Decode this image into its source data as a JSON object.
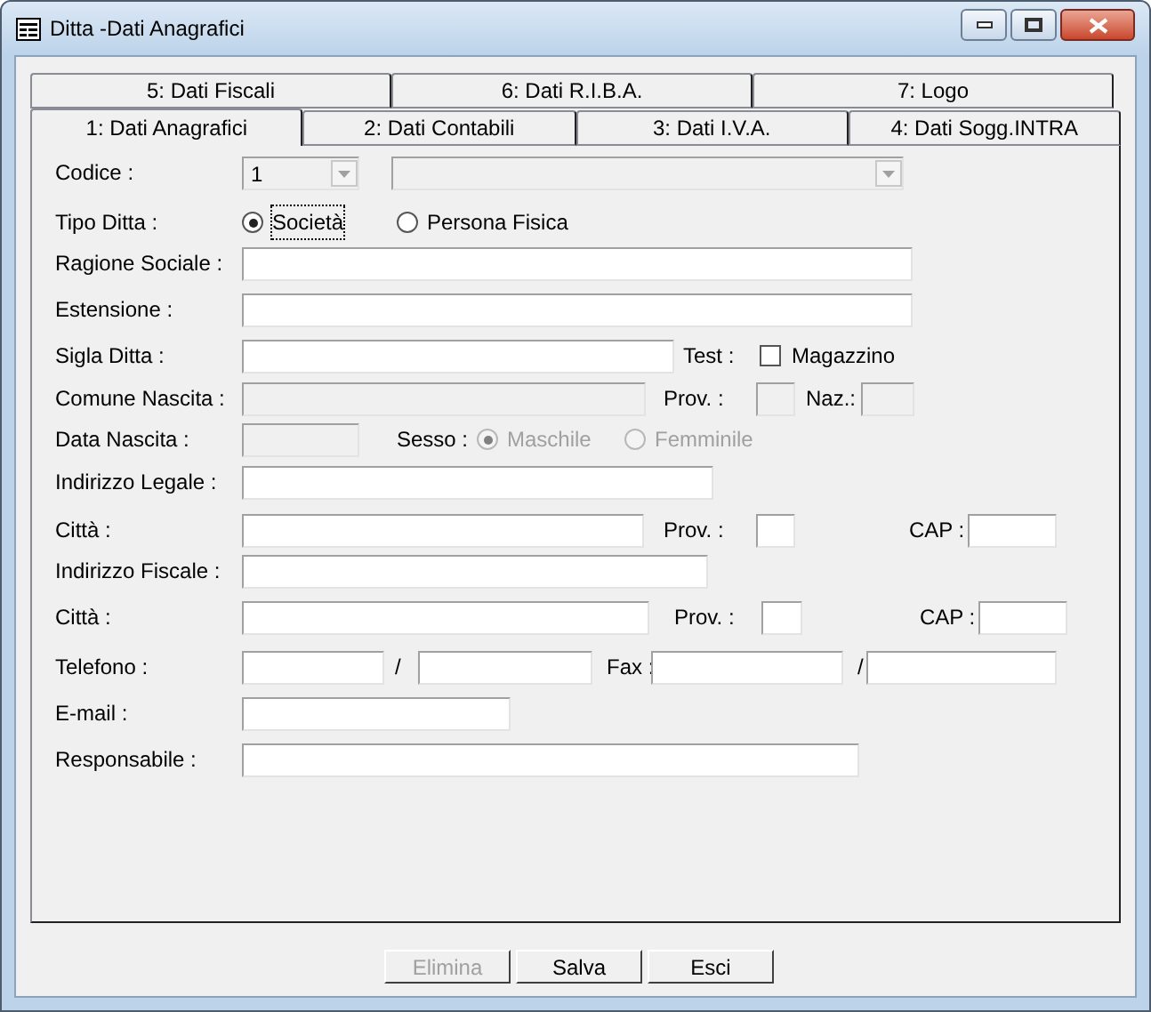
{
  "window": {
    "title": "Ditta -Dati Anagrafici"
  },
  "tab_rows": [
    {
      "tabs": [
        {
          "label": "5: Dati Fiscali",
          "selected": false
        },
        {
          "label": "6: Dati R.I.B.A.",
          "selected": false
        },
        {
          "label": "7: Logo",
          "selected": false
        }
      ]
    },
    {
      "tabs": [
        {
          "label": "1: Dati Anagrafici",
          "selected": true
        },
        {
          "label": "2: Dati Contabili",
          "selected": false
        },
        {
          "label": "3: Dati I.V.A.",
          "selected": false
        },
        {
          "label": "4: Dati Sogg.INTRA",
          "selected": false
        }
      ]
    }
  ],
  "rows": [
    {
      "items": [
        {
          "kind": "label",
          "text": "Codice :"
        },
        {
          "kind": "combo",
          "value": "1",
          "disabled": true
        },
        {
          "kind": "combo",
          "disabled": true
        }
      ]
    },
    {
      "items": [
        {
          "kind": "label",
          "text": "Tipo  Ditta :"
        },
        {
          "kind": "radio",
          "text": "Società",
          "selected": true,
          "disabled": false
        },
        {
          "kind": "radio",
          "text": "Persona Fisica",
          "selected": false,
          "disabled": false
        }
      ]
    },
    {
      "items": [
        {
          "kind": "label",
          "text": "Ragione Sociale :"
        },
        {
          "kind": "field",
          "disabled": false
        }
      ]
    },
    {
      "items": [
        {
          "kind": "label",
          "text": "Estensione :"
        },
        {
          "kind": "field",
          "disabled": false
        }
      ]
    },
    {
      "items": [
        {
          "kind": "label",
          "text": "Sigla Ditta :"
        },
        {
          "kind": "field",
          "disabled": false
        },
        {
          "kind": "label",
          "text": "Test :"
        },
        {
          "kind": "checkbox",
          "text": "Magazzino",
          "checked": false
        }
      ]
    },
    {
      "items": [
        {
          "kind": "label",
          "text": "Comune Nascita :"
        },
        {
          "kind": "field",
          "disabled": true
        },
        {
          "kind": "label",
          "text": "Prov. :"
        },
        {
          "kind": "field",
          "disabled": true
        },
        {
          "kind": "label",
          "text": "Naz.:"
        },
        {
          "kind": "field",
          "disabled": true
        }
      ]
    },
    {
      "items": [
        {
          "kind": "label",
          "text": "Data Nascita :"
        },
        {
          "kind": "field",
          "disabled": true
        },
        {
          "kind": "label",
          "text": "Sesso :"
        },
        {
          "kind": "radio",
          "text": "Maschile",
          "selected": true,
          "disabled": true
        },
        {
          "kind": "radio",
          "text": "Femminile",
          "selected": false,
          "disabled": true
        }
      ]
    },
    {
      "items": [
        {
          "kind": "label",
          "text": "Indirizzo Legale :"
        },
        {
          "kind": "field",
          "disabled": false
        }
      ]
    },
    {
      "items": [
        {
          "kind": "label",
          "text": "Città :"
        },
        {
          "kind": "field",
          "disabled": false
        },
        {
          "kind": "label",
          "text": "Prov. :"
        },
        {
          "kind": "field",
          "disabled": false
        },
        {
          "kind": "label",
          "text": "CAP :"
        },
        {
          "kind": "field",
          "disabled": false
        }
      ]
    },
    {
      "items": [
        {
          "kind": "label",
          "text": "Indirizzo Fiscale :"
        },
        {
          "kind": "field",
          "disabled": false
        }
      ]
    },
    {
      "items": [
        {
          "kind": "label",
          "text": "Città :"
        },
        {
          "kind": "field",
          "disabled": false
        },
        {
          "kind": "label",
          "text": "Prov. :"
        },
        {
          "kind": "field",
          "disabled": false
        },
        {
          "kind": "label",
          "text": "CAP :"
        },
        {
          "kind": "field",
          "disabled": false
        }
      ]
    },
    {
      "items": [
        {
          "kind": "label",
          "text": "Telefono :"
        },
        {
          "kind": "field",
          "disabled": false
        },
        {
          "kind": "label",
          "text": "/"
        },
        {
          "kind": "field",
          "disabled": false
        },
        {
          "kind": "label",
          "text": "Fax :"
        },
        {
          "kind": "field",
          "disabled": false
        },
        {
          "kind": "label",
          "text": "/"
        },
        {
          "kind": "field",
          "disabled": false
        }
      ]
    },
    {
      "items": [
        {
          "kind": "label",
          "text": "E-mail :"
        },
        {
          "kind": "field",
          "disabled": false
        }
      ]
    },
    {
      "items": [
        {
          "kind": "label",
          "text": "Responsabile :"
        },
        {
          "kind": "field",
          "disabled": false
        }
      ]
    }
  ],
  "buttons": [
    {
      "label": "Elimina",
      "disabled": true
    },
    {
      "label": "Salva",
      "disabled": false
    },
    {
      "label": "Esci",
      "disabled": false
    }
  ]
}
